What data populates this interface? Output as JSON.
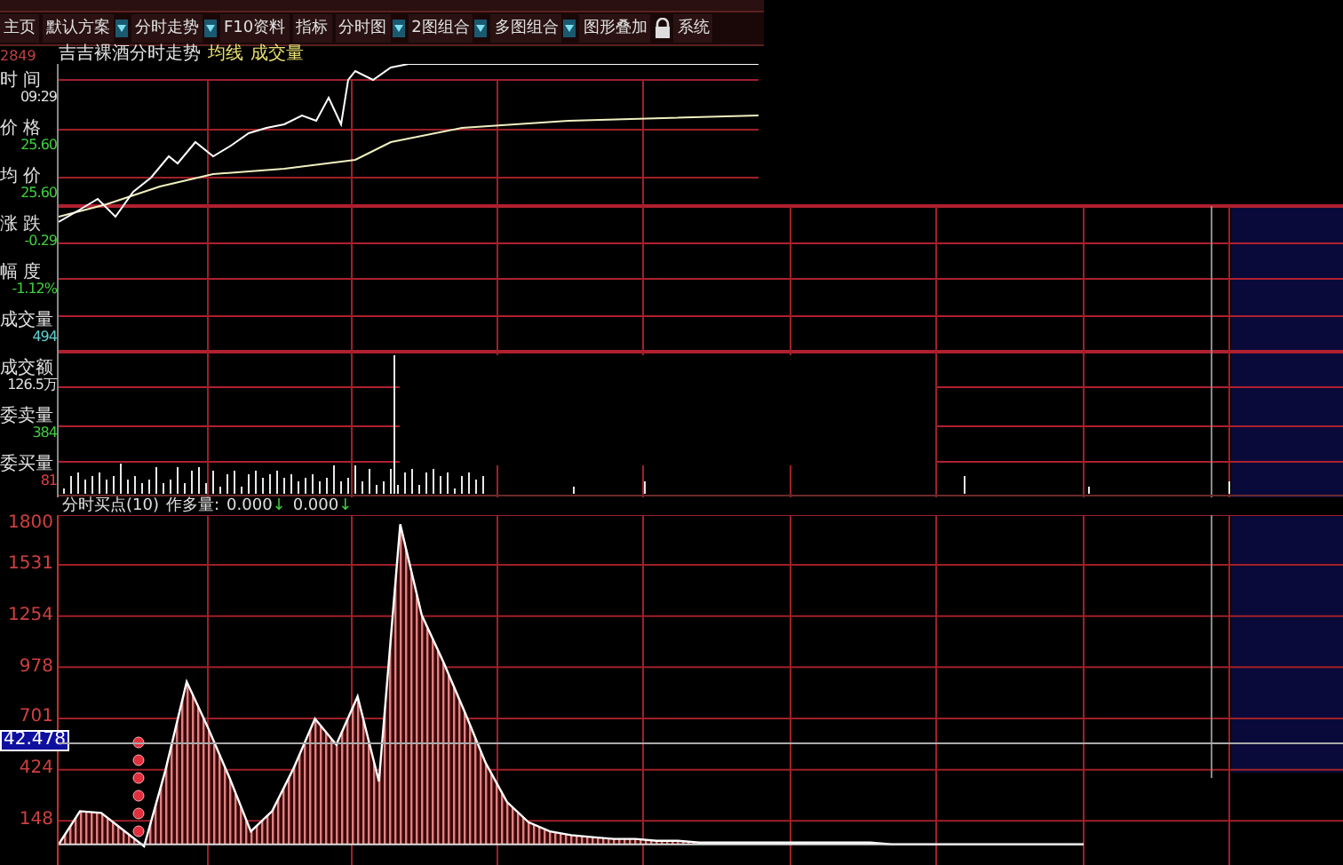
{
  "toolbar": {
    "items": [
      {
        "label": "主页",
        "dropdown": false,
        "lock": false
      },
      {
        "label": "默认方案",
        "dropdown": true,
        "lock": false
      },
      {
        "label": "分时走势",
        "dropdown": true,
        "lock": false
      },
      {
        "label": "F10资料",
        "dropdown": false,
        "lock": false
      },
      {
        "label": "指标",
        "dropdown": false,
        "lock": false
      },
      {
        "label": "分时图",
        "dropdown": true,
        "lock": false
      },
      {
        "label": "2图组合",
        "dropdown": true,
        "lock": false
      },
      {
        "label": "多图组合",
        "dropdown": true,
        "lock": false
      },
      {
        "label": "图形叠加",
        "dropdown": false,
        "lock": false
      },
      {
        "label": "系统",
        "dropdown": false,
        "lock": true
      }
    ]
  },
  "top_axis_label": "2849",
  "chart_title": [
    {
      "text": "吉吉裸酒分时走势",
      "color": "#e0e0e0"
    },
    {
      "text": "均线",
      "color": "#e8e070"
    },
    {
      "text": "成交量",
      "color": "#e8e070"
    }
  ],
  "info_panel": [
    {
      "label": "时 间",
      "value": "09:29",
      "color": "#e0e0e0"
    },
    {
      "label": "价 格",
      "value": "25.60",
      "color": "#40d040"
    },
    {
      "label": "均 价",
      "value": "25.60",
      "color": "#40d040"
    },
    {
      "label": "涨 跌",
      "value": "-0.29",
      "color": "#40d040"
    },
    {
      "label": "幅 度",
      "value": "-1.12%",
      "color": "#40d040"
    },
    {
      "label": "成交量",
      "value": "494",
      "color": "#60d0d0"
    },
    {
      "label": "成交额",
      "value": "126.5万",
      "color": "#e0e0e0"
    },
    {
      "label": "委卖量",
      "value": "384",
      "color": "#40d040"
    },
    {
      "label": "委买量",
      "value": "81",
      "color": "#e04040"
    }
  ],
  "indicator": {
    "label": "作多量:",
    "values": [
      {
        "value": "0.000",
        "arrow": "↓"
      },
      {
        "value": "0.000",
        "arrow": "↓"
      }
    ]
  },
  "indicator_axis": {
    "cursor_value": "42.478"
  },
  "chart_data": {
    "type": "area",
    "grid": true,
    "ylim": [
      -91,
      1800
    ],
    "yticks": [
      148,
      424,
      701,
      978,
      1254,
      1531,
      1800
    ],
    "series": [
      {
        "name": "分时买点(10)",
        "color": "#ffffff",
        "values": [
          20,
          200,
          190,
          100,
          10,
          420,
          900,
          650,
          380,
          90,
          200,
          430,
          700,
          560,
          820,
          360,
          1750,
          1260,
          1010,
          740,
          460,
          250,
          140,
          90,
          70,
          60,
          50,
          50,
          40,
          40,
          30,
          30,
          30,
          30,
          30,
          30,
          30,
          30,
          30,
          20,
          20,
          20,
          20,
          20,
          20,
          20,
          20,
          20,
          20
        ]
      }
    ]
  }
}
